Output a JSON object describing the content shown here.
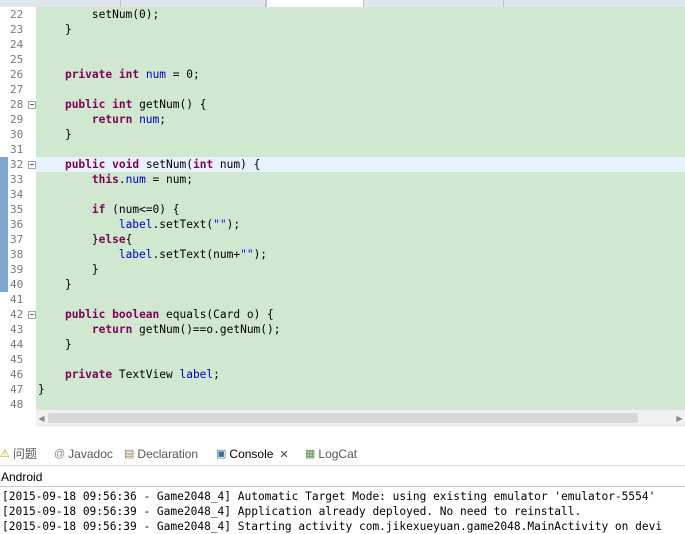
{
  "editor": {
    "lines": [
      {
        "n": "22",
        "fold": false,
        "segs": [
          {
            "t": "        setNum(0);",
            "c": ""
          }
        ]
      },
      {
        "n": "23",
        "fold": false,
        "segs": [
          {
            "t": "    }",
            "c": ""
          }
        ]
      },
      {
        "n": "24",
        "fold": false,
        "segs": []
      },
      {
        "n": "25",
        "fold": false,
        "segs": []
      },
      {
        "n": "26",
        "fold": false,
        "segs": [
          {
            "t": "    ",
            "c": ""
          },
          {
            "t": "private",
            "c": "kw"
          },
          {
            "t": " ",
            "c": ""
          },
          {
            "t": "int",
            "c": "kw"
          },
          {
            "t": " ",
            "c": ""
          },
          {
            "t": "num",
            "c": "fld"
          },
          {
            "t": " = 0;",
            "c": ""
          }
        ]
      },
      {
        "n": "27",
        "fold": false,
        "segs": []
      },
      {
        "n": "28",
        "fold": true,
        "segs": [
          {
            "t": "    ",
            "c": ""
          },
          {
            "t": "public",
            "c": "kw"
          },
          {
            "t": " ",
            "c": ""
          },
          {
            "t": "int",
            "c": "kw"
          },
          {
            "t": " getNum() {",
            "c": ""
          }
        ]
      },
      {
        "n": "29",
        "fold": false,
        "segs": [
          {
            "t": "        ",
            "c": ""
          },
          {
            "t": "return",
            "c": "kw"
          },
          {
            "t": " ",
            "c": ""
          },
          {
            "t": "num",
            "c": "fld"
          },
          {
            "t": ";",
            "c": ""
          }
        ]
      },
      {
        "n": "30",
        "fold": false,
        "segs": [
          {
            "t": "    }",
            "c": ""
          }
        ]
      },
      {
        "n": "31",
        "fold": false,
        "segs": []
      },
      {
        "n": "32",
        "fold": true,
        "current": true,
        "segs": [
          {
            "t": "    ",
            "c": ""
          },
          {
            "t": "public",
            "c": "kw"
          },
          {
            "t": " ",
            "c": ""
          },
          {
            "t": "void",
            "c": "kw"
          },
          {
            "t": " setNum(",
            "c": ""
          },
          {
            "t": "int",
            "c": "kw"
          },
          {
            "t": " num) {",
            "c": ""
          }
        ]
      },
      {
        "n": "33",
        "fold": false,
        "segs": [
          {
            "t": "        ",
            "c": ""
          },
          {
            "t": "this",
            "c": "kw"
          },
          {
            "t": ".",
            "c": ""
          },
          {
            "t": "num",
            "c": "fld"
          },
          {
            "t": " = num;",
            "c": ""
          }
        ]
      },
      {
        "n": "34",
        "fold": false,
        "segs": []
      },
      {
        "n": "35",
        "fold": false,
        "segs": [
          {
            "t": "        ",
            "c": ""
          },
          {
            "t": "if",
            "c": "kw"
          },
          {
            "t": " (num<=0) {",
            "c": ""
          }
        ]
      },
      {
        "n": "36",
        "fold": false,
        "segs": [
          {
            "t": "            ",
            "c": ""
          },
          {
            "t": "label",
            "c": "fld"
          },
          {
            "t": ".setText(",
            "c": ""
          },
          {
            "t": "\"\"",
            "c": "str"
          },
          {
            "t": ");",
            "c": ""
          }
        ]
      },
      {
        "n": "37",
        "fold": false,
        "segs": [
          {
            "t": "        }",
            "c": ""
          },
          {
            "t": "else",
            "c": "kw"
          },
          {
            "t": "{",
            "c": ""
          }
        ]
      },
      {
        "n": "38",
        "fold": false,
        "segs": [
          {
            "t": "            ",
            "c": ""
          },
          {
            "t": "label",
            "c": "fld"
          },
          {
            "t": ".setText(num+",
            "c": ""
          },
          {
            "t": "\"\"",
            "c": "str"
          },
          {
            "t": ");",
            "c": ""
          }
        ]
      },
      {
        "n": "39",
        "fold": false,
        "segs": [
          {
            "t": "        }",
            "c": ""
          }
        ]
      },
      {
        "n": "40",
        "fold": false,
        "segs": [
          {
            "t": "    }",
            "c": ""
          }
        ]
      },
      {
        "n": "41",
        "fold": false,
        "segs": []
      },
      {
        "n": "42",
        "fold": true,
        "segs": [
          {
            "t": "    ",
            "c": ""
          },
          {
            "t": "public",
            "c": "kw"
          },
          {
            "t": " ",
            "c": ""
          },
          {
            "t": "boolean",
            "c": "kw"
          },
          {
            "t": " equals(Card o) {",
            "c": ""
          }
        ]
      },
      {
        "n": "43",
        "fold": false,
        "segs": [
          {
            "t": "        ",
            "c": ""
          },
          {
            "t": "return",
            "c": "kw"
          },
          {
            "t": " getNum()==o.getNum();",
            "c": ""
          }
        ]
      },
      {
        "n": "44",
        "fold": false,
        "segs": [
          {
            "t": "    }",
            "c": ""
          }
        ]
      },
      {
        "n": "45",
        "fold": false,
        "segs": []
      },
      {
        "n": "46",
        "fold": false,
        "segs": [
          {
            "t": "    ",
            "c": ""
          },
          {
            "t": "private",
            "c": "kw"
          },
          {
            "t": " TextView ",
            "c": ""
          },
          {
            "t": "label",
            "c": "fld"
          },
          {
            "t": ";",
            "c": ""
          }
        ]
      },
      {
        "n": "47",
        "fold": false,
        "segs": [
          {
            "t": "}",
            "c": ""
          }
        ]
      },
      {
        "n": "48",
        "fold": false,
        "segs": []
      }
    ]
  },
  "views": {
    "tabs": [
      {
        "key": "problems",
        "icon": "⚠",
        "label": "问题",
        "active": false
      },
      {
        "key": "javadoc",
        "icon": "@",
        "label": "Javadoc",
        "active": false
      },
      {
        "key": "declaration",
        "icon": "▤",
        "label": "Declaration",
        "active": false
      },
      {
        "key": "console",
        "icon": "▣",
        "label": "Console",
        "active": true,
        "close": "✕"
      },
      {
        "key": "logcat",
        "icon": "▦",
        "label": "LogCat",
        "active": false
      }
    ]
  },
  "console": {
    "title": "Android",
    "lines": [
      "[2015-09-18 09:56:36 - Game2048_4] Automatic Target Mode: using existing emulator 'emulator-5554'",
      "[2015-09-18 09:56:39 - Game2048_4] Application already deployed. No need to reinstall.",
      "[2015-09-18 09:56:39 - Game2048_4] Starting activity com.jikexueyuan.game2048.MainActivity on devi"
    ]
  },
  "colors": {
    "code_background": "#cfe8cf",
    "keyword": "#7f0055",
    "field": "#0000c0",
    "string": "#2a00ff",
    "current_line": "#e8f2fe"
  }
}
